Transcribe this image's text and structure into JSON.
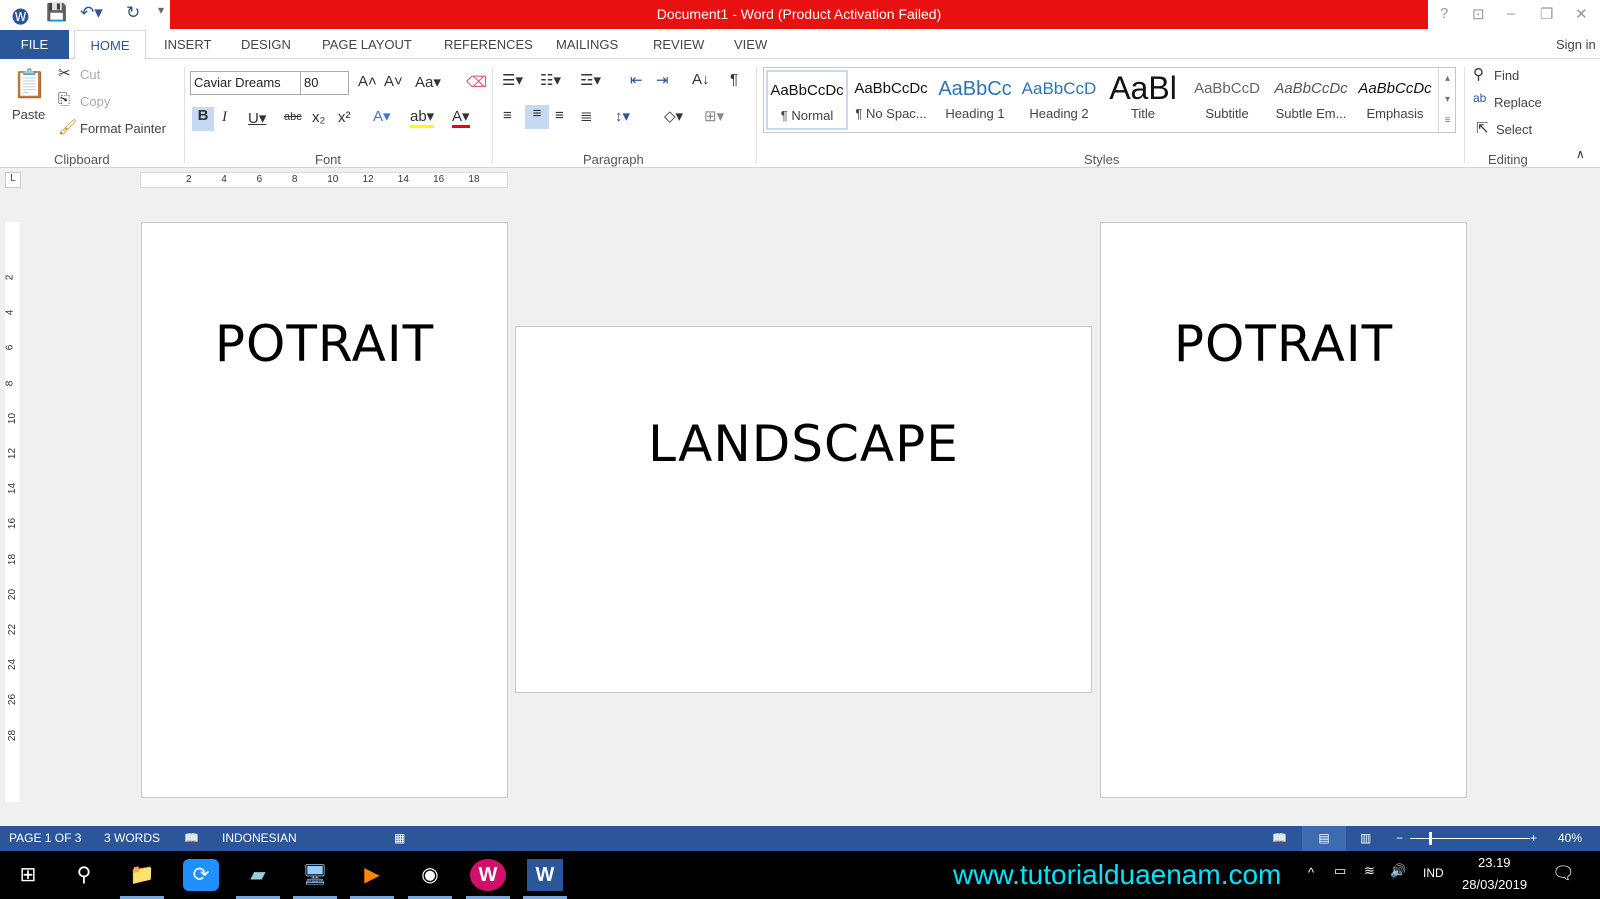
{
  "window": {
    "title": "Document1 -  Word (Product Activation Failed)",
    "sign_in": "Sign in"
  },
  "tabs": [
    "FILE",
    "HOME",
    "INSERT",
    "DESIGN",
    "PAGE LAYOUT",
    "REFERENCES",
    "MAILINGS",
    "REVIEW",
    "VIEW"
  ],
  "clipboard": {
    "paste": "Paste",
    "cut": "Cut",
    "copy": "Copy",
    "format_painter": "Format Painter",
    "group": "Clipboard"
  },
  "font": {
    "name": "Caviar Dreams",
    "size": "80",
    "group": "Font"
  },
  "paragraph": {
    "group": "Paragraph"
  },
  "styles": {
    "group": "Styles",
    "items": [
      {
        "preview": "AaBbCcDc",
        "label": "¶ Normal"
      },
      {
        "preview": "AaBbCcDc",
        "label": "¶ No Spac..."
      },
      {
        "preview": "AaBbCc",
        "label": "Heading 1"
      },
      {
        "preview": "AaBbCcD",
        "label": "Heading 2"
      },
      {
        "preview": "AaBl",
        "label": "Title"
      },
      {
        "preview": "AaBbCcD",
        "label": "Subtitle"
      },
      {
        "preview": "AaBbCcDc",
        "label": "Subtle Em..."
      },
      {
        "preview": "AaBbCcDc",
        "label": "Emphasis"
      }
    ]
  },
  "editing": {
    "find": "Find",
    "replace": "Replace",
    "select": "Select",
    "group": "Editing"
  },
  "ruler": [
    "2",
    "4",
    "6",
    "8",
    "10",
    "12",
    "14",
    "16",
    "18"
  ],
  "vruler": [
    "2",
    "4",
    "6",
    "8",
    "10",
    "12",
    "14",
    "16",
    "18",
    "20",
    "22",
    "24",
    "26",
    "28"
  ],
  "pages": {
    "left": "POTRAIT",
    "middle": "LANDSCAPE",
    "right": "POTRAIT"
  },
  "status": {
    "page": "PAGE 1 OF 3",
    "words": "3 WORDS",
    "language": "INDONESIAN",
    "zoom": "40%",
    "zoom_level": 40
  },
  "taskbar": {
    "watermark": "www.tutorialduaenam.com",
    "lang": "IND",
    "time": "23.19",
    "date": "28/03/2019"
  },
  "colors": {
    "accent": "#2b579a",
    "title_red": "#e81010",
    "watermark": "#00e5ff"
  }
}
